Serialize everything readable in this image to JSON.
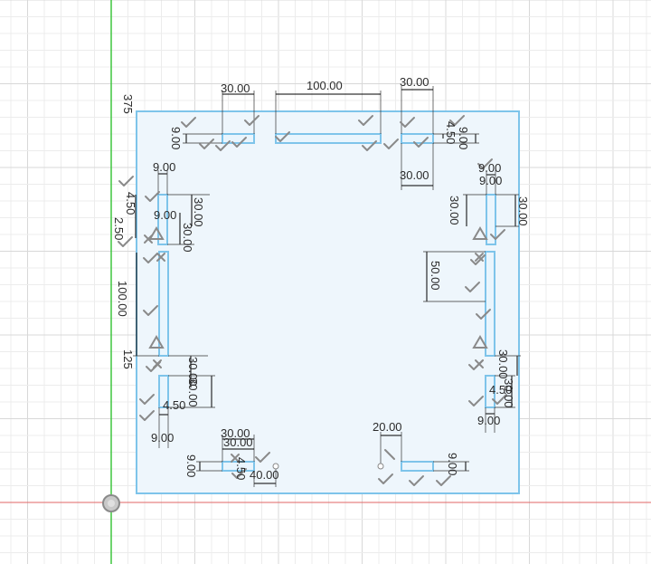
{
  "view": {
    "axis_labels": [
      "375",
      "125"
    ],
    "colors": {
      "grid_minor": "#ececec",
      "grid_major": "#d8d8d8",
      "sketch_fill": "#eef6fc",
      "sketch_stroke": "#7ec4ea",
      "y_axis": "#3ec53e",
      "x_axis": "#e06666",
      "dimension": "#000000"
    }
  },
  "dimensions": [
    {
      "id": "top-left-width",
      "text": "30.00"
    },
    {
      "id": "top-center-width",
      "text": "100.00"
    },
    {
      "id": "top-right-width",
      "text": "30.00"
    },
    {
      "id": "top-right-under-width",
      "text": "30.00"
    },
    {
      "id": "top-left-height",
      "text": "9.00"
    },
    {
      "id": "top-right-height-a",
      "text": "9.00"
    },
    {
      "id": "top-right-height-b",
      "text": "4.50"
    },
    {
      "id": "left-top-width",
      "text": "9.00"
    },
    {
      "id": "left-top-offset",
      "text": "9.00"
    },
    {
      "id": "left-top-h1",
      "text": "30.00"
    },
    {
      "id": "left-top-h2",
      "text": "30.00"
    },
    {
      "id": "left-top-small-a",
      "text": "4.50"
    },
    {
      "id": "left-top-small-b",
      "text": "2.50"
    },
    {
      "id": "left-mid-length",
      "text": "100.00"
    },
    {
      "id": "left-bottom-h1",
      "text": "30.00"
    },
    {
      "id": "left-bottom-h2",
      "text": "30.00"
    },
    {
      "id": "left-bottom-small",
      "text": "4.50"
    },
    {
      "id": "left-bottom-width",
      "text": "9.00"
    },
    {
      "id": "right-top-width-a",
      "text": "9.00"
    },
    {
      "id": "right-top-width-b",
      "text": "9.00"
    },
    {
      "id": "right-top-h1",
      "text": "30.00"
    },
    {
      "id": "right-top-h2",
      "text": "30.00"
    },
    {
      "id": "right-mid-length",
      "text": "50.00"
    },
    {
      "id": "right-bottom-h1",
      "text": "30.00"
    },
    {
      "id": "right-bottom-h2",
      "text": "30.00"
    },
    {
      "id": "right-bottom-small",
      "text": "4.50"
    },
    {
      "id": "right-bottom-width",
      "text": "9.00"
    },
    {
      "id": "bottom-left-width-a",
      "text": "30.00"
    },
    {
      "id": "bottom-left-width-b",
      "text": "30.00"
    },
    {
      "id": "bottom-left-height",
      "text": "9.00"
    },
    {
      "id": "bottom-left-small",
      "text": "4.50"
    },
    {
      "id": "bottom-left-offset",
      "text": "40.00"
    },
    {
      "id": "bottom-right-width",
      "text": "20.00"
    },
    {
      "id": "bottom-right-height",
      "text": "9.00"
    }
  ]
}
